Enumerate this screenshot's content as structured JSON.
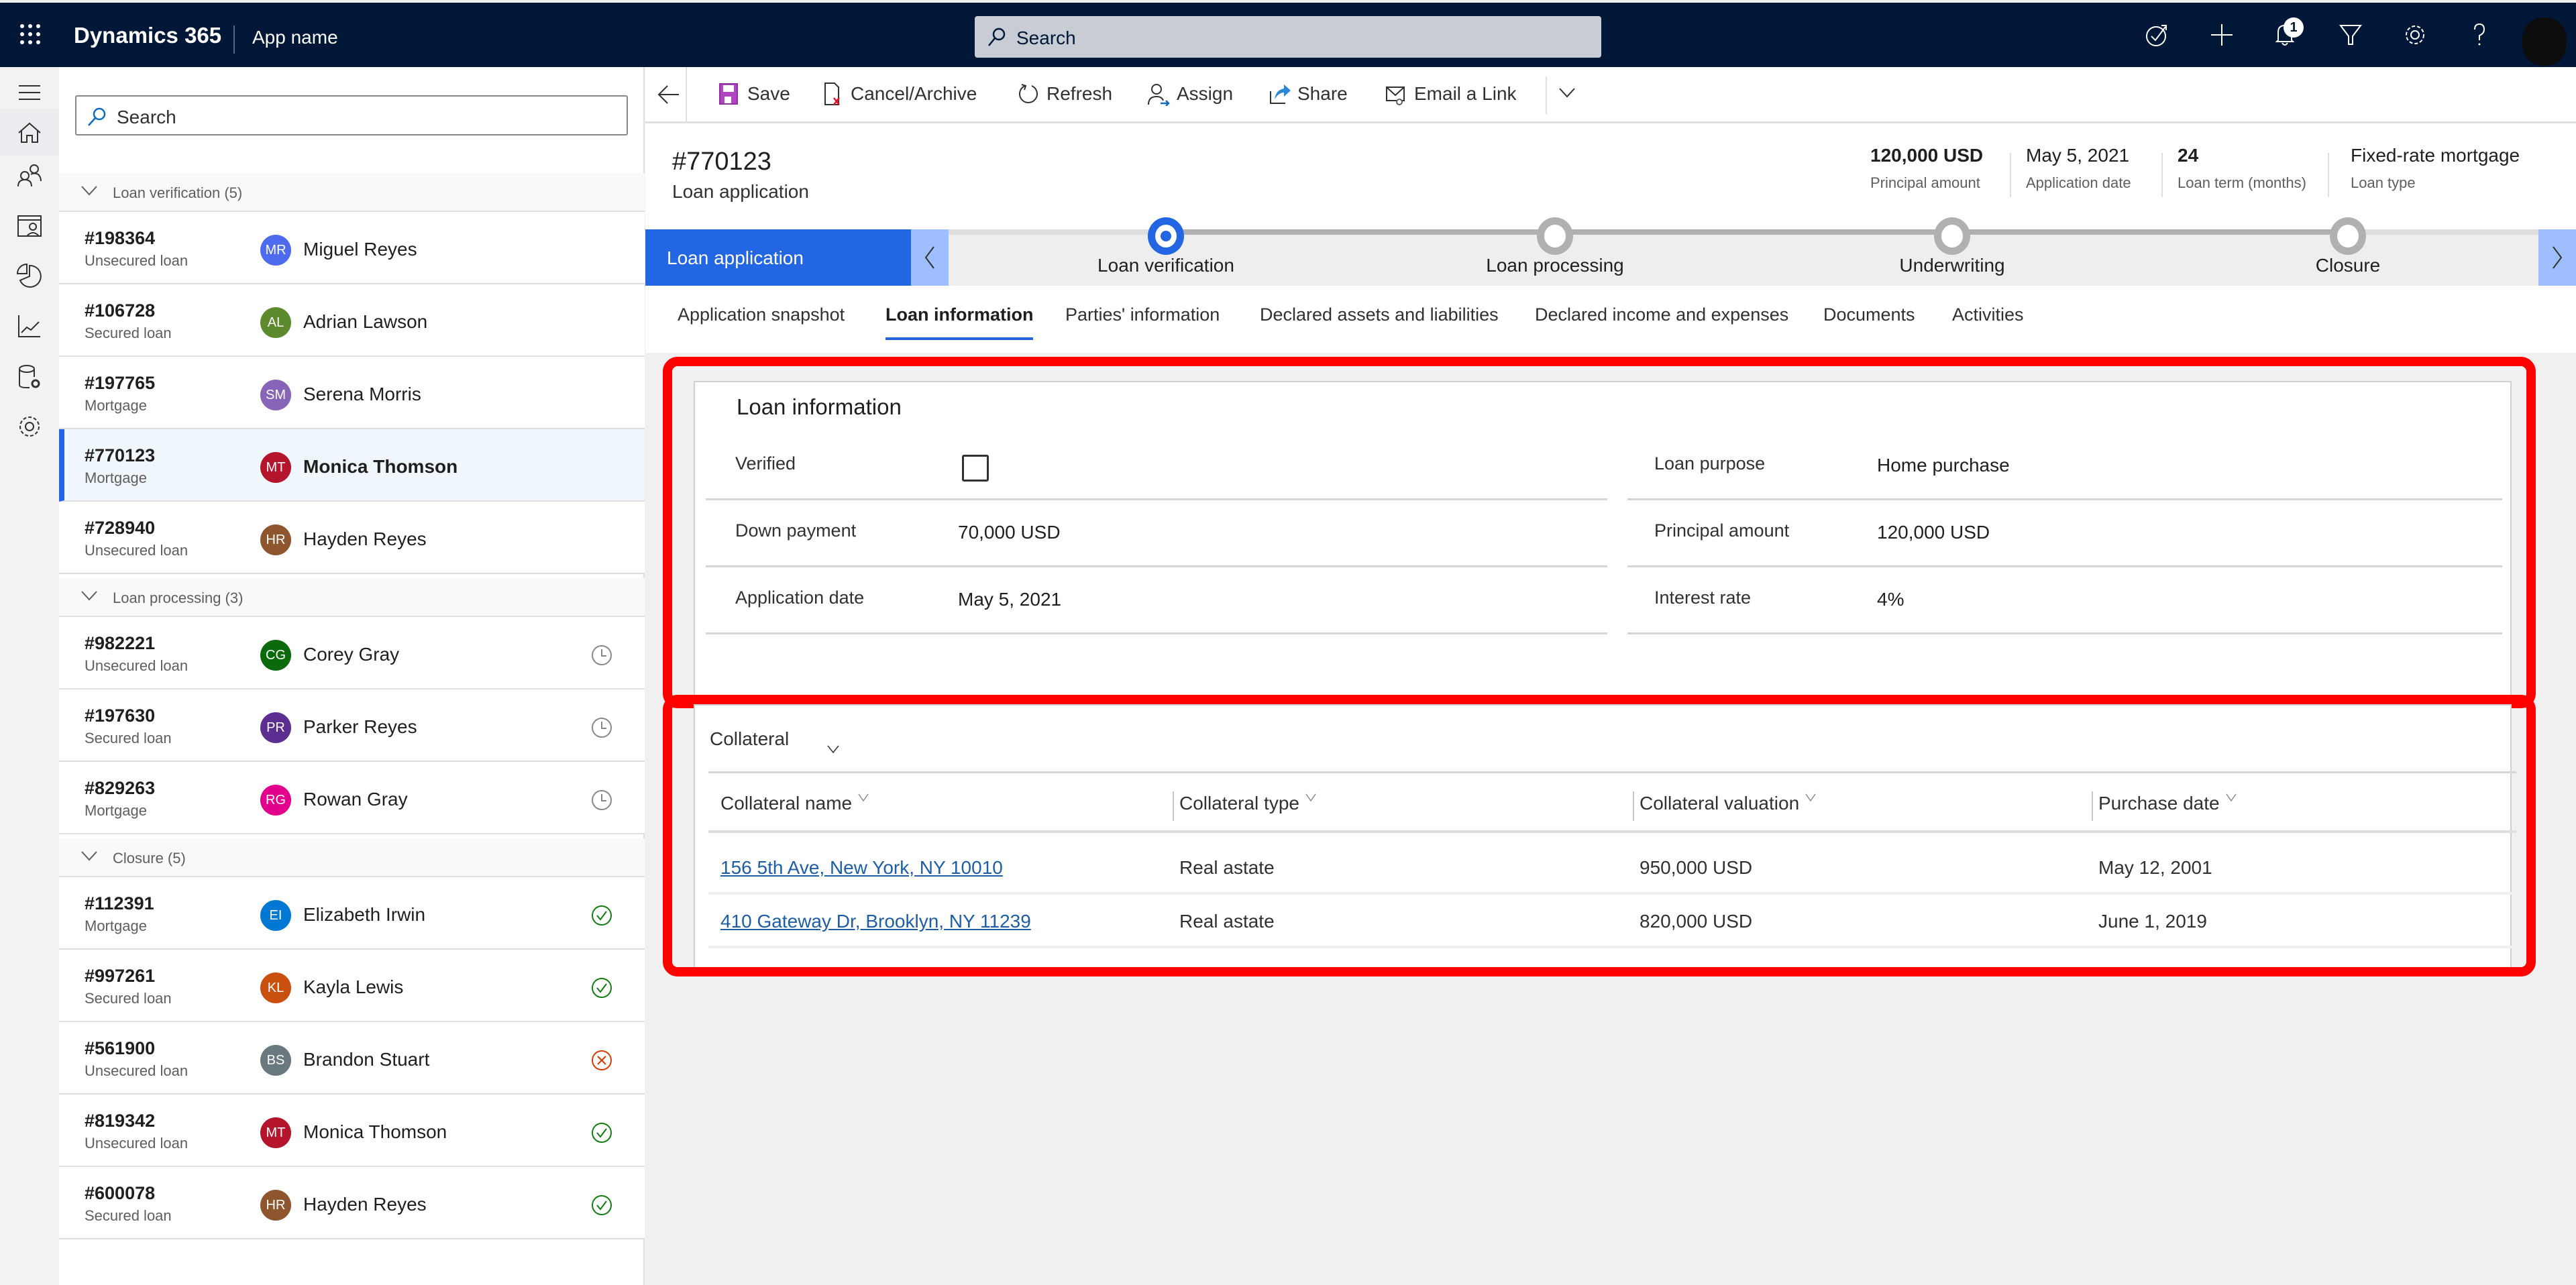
{
  "topbar": {
    "brand": "Dynamics 365",
    "app_name": "App name",
    "search_placeholder": "Search",
    "notification_count": "1",
    "icons": [
      "app-launcher-icon",
      "task-flow-icon",
      "plus-icon",
      "bell-icon",
      "filter-icon",
      "gear-icon",
      "help-icon",
      "user-avatar"
    ]
  },
  "leftnav": {
    "icons": [
      "hamburger-icon",
      "home-icon",
      "people-icon",
      "calendar-person-icon",
      "pie-chart-icon",
      "trend-chart-icon",
      "database-settings-icon",
      "gear-icon"
    ]
  },
  "list": {
    "search_placeholder": "Search",
    "groups": [
      {
        "label": "Loan verification (5)"
      },
      {
        "label": "Loan processing (3)"
      },
      {
        "label": "Closure (5)"
      }
    ],
    "rows": [
      {
        "id": "#198364",
        "type": "Unsecured loan",
        "initials": "MR",
        "name": "Miguel Reyes",
        "color": "#4f6bed",
        "status": ""
      },
      {
        "id": "#106728",
        "type": "Secured loan",
        "initials": "AL",
        "name": "Adrian Lawson",
        "color": "#5e8a2e",
        "status": ""
      },
      {
        "id": "#197765",
        "type": "Mortgage",
        "initials": "SM",
        "name": "Serena Morris",
        "color": "#8764b8",
        "status": ""
      },
      {
        "id": "#770123",
        "type": "Mortgage",
        "initials": "MT",
        "name": "Monica Thomson",
        "color": "#b4152d",
        "status": "",
        "selected": true
      },
      {
        "id": "#728940",
        "type": "Unsecured loan",
        "initials": "HR",
        "name": "Hayden Reyes",
        "color": "#8e562e",
        "status": ""
      },
      {
        "id": "#982221",
        "type": "Unsecured loan",
        "initials": "CG",
        "name": "Corey Gray",
        "color": "#0b6a0b",
        "status": "pending"
      },
      {
        "id": "#197630",
        "type": "Secured loan",
        "initials": "PR",
        "name": "Parker Reyes",
        "color": "#5c2e91",
        "status": "pending"
      },
      {
        "id": "#829263",
        "type": "Mortgage",
        "initials": "RG",
        "name": "Rowan Gray",
        "color": "#e3008c",
        "status": "pending"
      },
      {
        "id": "#112391",
        "type": "Mortgage",
        "initials": "EI",
        "name": "Elizabeth Irwin",
        "color": "#0078d4",
        "status": "approved"
      },
      {
        "id": "#997261",
        "type": "Secured loan",
        "initials": "KL",
        "name": "Kayla Lewis",
        "color": "#ca5010",
        "status": "approved"
      },
      {
        "id": "#561900",
        "type": "Unsecured loan",
        "initials": "BS",
        "name": "Brandon Stuart",
        "color": "#69797e",
        "status": "rejected"
      },
      {
        "id": "#819342",
        "type": "Unsecured loan",
        "initials": "MT",
        "name": "Monica Thomson",
        "color": "#b4152d",
        "status": "approved"
      },
      {
        "id": "#600078",
        "type": "Secured loan",
        "initials": "HR",
        "name": "Hayden Reyes",
        "color": "#8e562e",
        "status": "approved"
      }
    ]
  },
  "commands": {
    "save": "Save",
    "cancel_archive": "Cancel/Archive",
    "refresh": "Refresh",
    "assign": "Assign",
    "share": "Share",
    "email_link": "Email a Link"
  },
  "record": {
    "id": "#770123",
    "type": "Loan application",
    "header_fields": [
      {
        "value": "120,000 USD",
        "label": "Principal amount"
      },
      {
        "value": "May 5, 2021",
        "label": "Application date"
      },
      {
        "value": "24",
        "label": "Loan term (months)"
      },
      {
        "value": "Fixed-rate mortgage",
        "label": "Loan type"
      }
    ]
  },
  "process": {
    "active_label": "Loan application",
    "stages": [
      "Loan verification",
      "Loan processing",
      "Underwriting",
      "Closure"
    ],
    "current_stage": "Loan verification"
  },
  "tabs": [
    "Application snapshot",
    "Loan information",
    "Parties' information",
    "Declared assets and liabilities",
    "Declared income and expenses",
    "Documents",
    "Activities"
  ],
  "active_tab": "Loan information",
  "loan_info": {
    "title": "Loan information",
    "left": [
      {
        "label": "Verified",
        "value": "",
        "checked": false
      },
      {
        "label": "Down payment",
        "value": "70,000 USD"
      },
      {
        "label": "Application date",
        "value": "May 5, 2021"
      }
    ],
    "right": [
      {
        "label": "Loan purpose",
        "value": "Home purchase"
      },
      {
        "label": "Principal amount",
        "value": "120,000 USD"
      },
      {
        "label": "Interest rate",
        "value": "4%"
      }
    ]
  },
  "collateral": {
    "title": "Collateral",
    "columns": [
      "Collateral name",
      "Collateral type",
      "Collateral valuation",
      "Purchase date"
    ],
    "rows": [
      {
        "name": "156 5th Ave, New York, NY 10010",
        "type": "Real astate",
        "valuation": "950,000 USD",
        "date": "May 12, 2001"
      },
      {
        "name": "410 Gateway Dr, Brooklyn, NY 11239",
        "type": "Real astate",
        "valuation": "820,000 USD",
        "date": "June 1, 2019"
      }
    ]
  },
  "colors": {
    "topbar": "#001737",
    "accent": "#2266e3",
    "highlight": "#ff0000",
    "approved": "#107c10",
    "rejected": "#d83b01",
    "link": "#1d5ea7"
  }
}
